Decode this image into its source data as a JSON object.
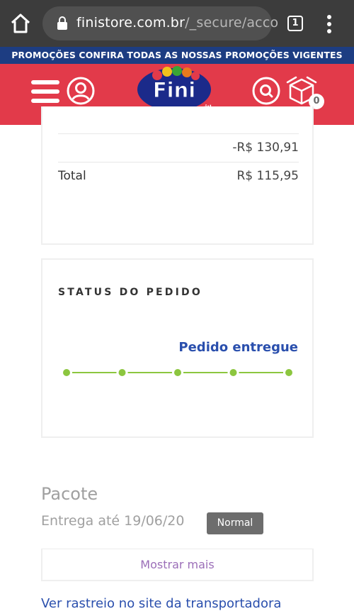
{
  "browser": {
    "url_host": "finistore.com.br",
    "url_path": "/_secure/acco",
    "tab_count": "1",
    "icons": {
      "home": "home-icon",
      "lock": "lock-icon",
      "menu": "vertical-dots-icon"
    }
  },
  "promo_bar": {
    "text": "PROMOÇÕES CONFIRA TODAS AS NOSSAS PROMOÇÕES VIGENTES"
  },
  "header": {
    "logo_text": "Fini",
    "logo_tagline": "Abriu, sorriu",
    "cart_count": "0",
    "colors": {
      "header_bg": "#e23a4a",
      "promo_bg": "#1d3d82"
    }
  },
  "order_summary": {
    "rows": [
      {
        "label": "",
        "value": "-R$ 130,91"
      },
      {
        "label": "Total",
        "value": "R$ 115,95"
      }
    ]
  },
  "order_status": {
    "title": "STATUS DO PEDIDO",
    "status_text": "Pedido entregue",
    "steps_total": 5,
    "steps_completed": 5,
    "progress_color": "#8cc63f"
  },
  "package": {
    "title": "Pacote",
    "delivery_text": "Entrega até 19/06/20",
    "shipping_badge": "Normal",
    "show_more_label": "Mostrar mais",
    "tracking_link": "Ver rastreio no site da transportadora"
  }
}
